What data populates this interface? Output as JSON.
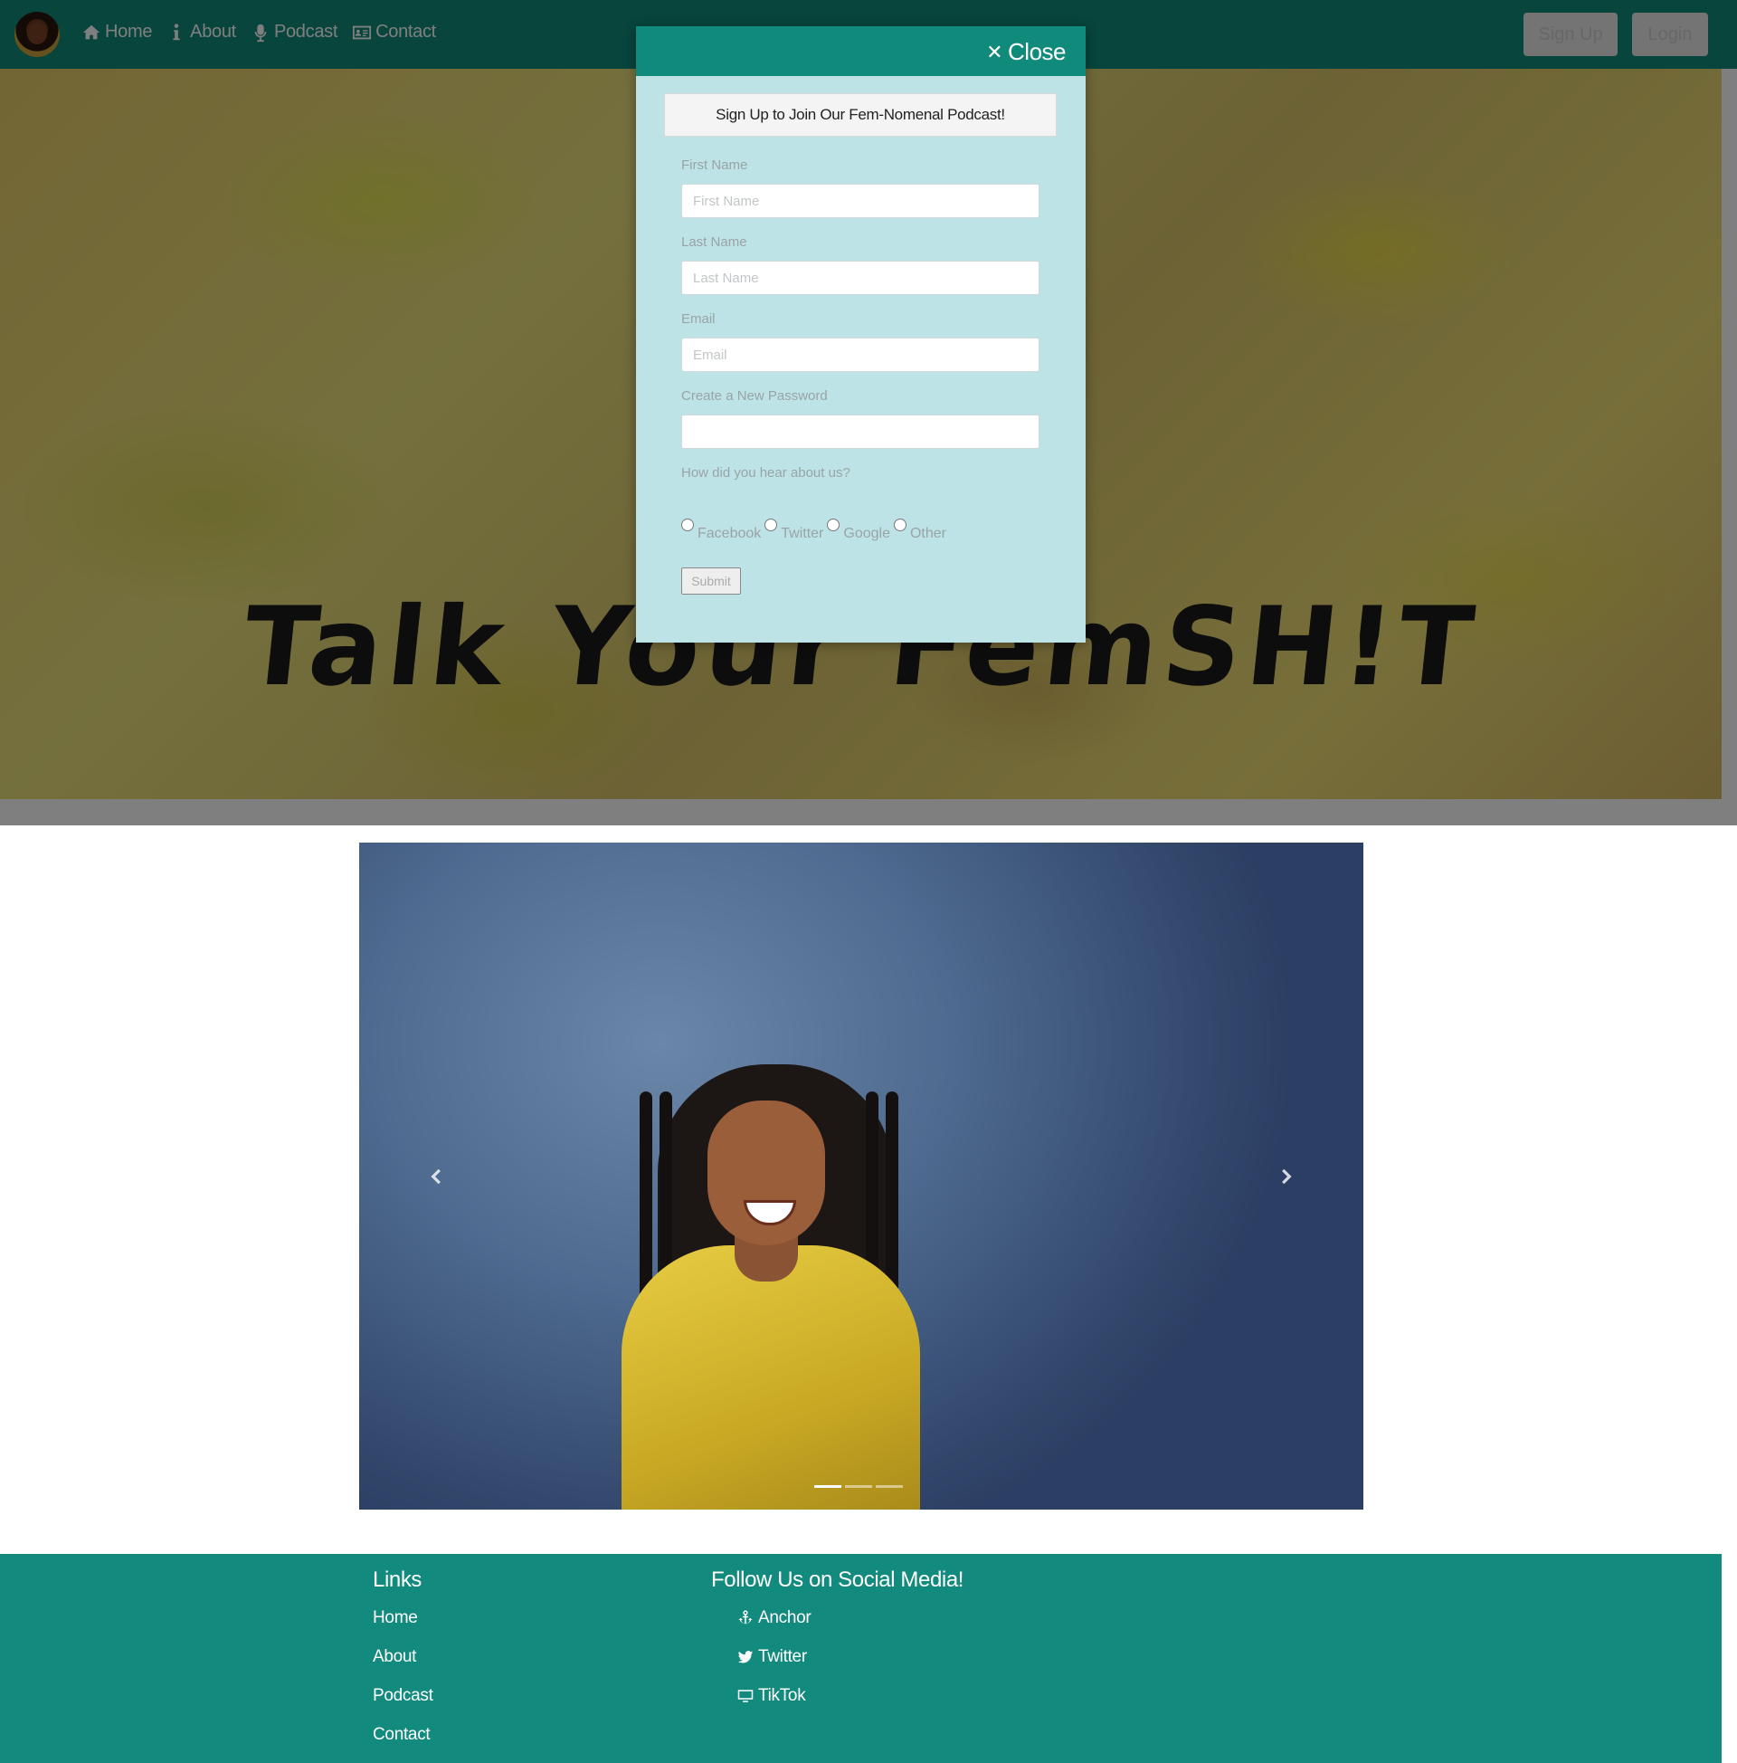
{
  "navbar": {
    "links": [
      {
        "label": "Home",
        "icon": "home-icon"
      },
      {
        "label": "About",
        "icon": "info-icon"
      },
      {
        "label": "Podcast",
        "icon": "microphone-icon"
      },
      {
        "label": "Contact",
        "icon": "contact-card-icon"
      }
    ],
    "signup_label": "Sign Up",
    "login_label": "Login"
  },
  "hero": {
    "title": "Talk Your FemSH!T"
  },
  "modal": {
    "close_label": "Close",
    "title": "Sign Up to Join Our Fem-Nomenal Podcast!",
    "fields": {
      "first_name": {
        "label": "First Name",
        "placeholder": "First Name",
        "value": ""
      },
      "last_name": {
        "label": "Last Name",
        "placeholder": "Last Name",
        "value": ""
      },
      "email": {
        "label": "Email",
        "placeholder": "Email",
        "value": ""
      },
      "password": {
        "label": "Create a New Password",
        "placeholder": "",
        "value": ""
      }
    },
    "referral_question": "How did you hear about us?",
    "referral_options": [
      "Facebook",
      "Twitter",
      "Google",
      "Other"
    ],
    "submit_label": "Submit"
  },
  "carousel": {
    "slide_count": 3,
    "active_index": 0
  },
  "footer": {
    "links_title": "Links",
    "links": [
      "Home",
      "About",
      "Podcast",
      "Contact"
    ],
    "social_title": "Follow Us on Social Media!",
    "social": [
      {
        "label": "Anchor",
        "icon": "anchor-icon"
      },
      {
        "label": "Twitter",
        "icon": "twitter-icon"
      },
      {
        "label": "TikTok",
        "icon": "monitor-icon"
      }
    ]
  },
  "colors": {
    "primary": "#0f8a7b",
    "modal_bg": "#bde3e6",
    "footer_bg": "#128a7d"
  }
}
